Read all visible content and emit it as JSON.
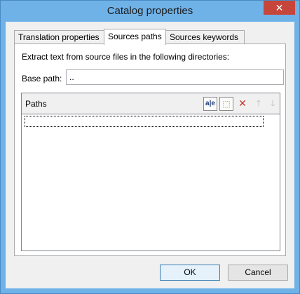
{
  "window": {
    "title": "Catalog properties",
    "close_glyph": "✕"
  },
  "tabs": [
    {
      "label": "Translation properties",
      "active": false
    },
    {
      "label": "Sources paths",
      "active": true
    },
    {
      "label": "Sources keywords",
      "active": false
    }
  ],
  "sources": {
    "description": "Extract text from source files in the following directories:",
    "base_path_label": "Base path:",
    "base_path_value": "..",
    "paths_title": "Paths",
    "toolbar": [
      {
        "name": "edit-path-icon",
        "glyph": "a|e",
        "enabled": true
      },
      {
        "name": "add-path-icon",
        "glyph": "⬚",
        "enabled": true
      },
      {
        "name": "delete-path-icon",
        "glyph": "✕",
        "enabled": true,
        "color": "#c0392b"
      },
      {
        "name": "move-up-icon",
        "glyph": "🡑",
        "enabled": false
      },
      {
        "name": "move-down-icon",
        "glyph": "🡓",
        "enabled": false
      }
    ],
    "paths": [
      ""
    ]
  },
  "buttons": {
    "ok": "OK",
    "cancel": "Cancel"
  }
}
